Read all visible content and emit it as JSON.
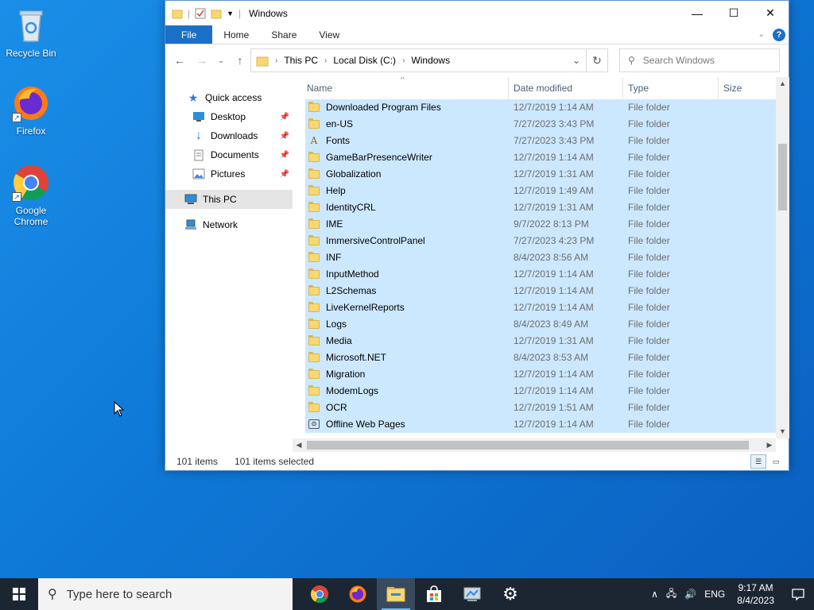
{
  "desktop": {
    "icons": [
      {
        "label": "Recycle Bin"
      },
      {
        "label": "Firefox"
      },
      {
        "label": "Google Chrome"
      }
    ]
  },
  "window": {
    "title": "Windows",
    "ribbon_tabs": [
      "File",
      "Home",
      "Share",
      "View"
    ],
    "address": {
      "crumbs": [
        "This PC",
        "Local Disk (C:)",
        "Windows"
      ]
    },
    "search_placeholder": "Search Windows",
    "nav": {
      "quick_access": "Quick access",
      "items": [
        "Desktop",
        "Downloads",
        "Documents",
        "Pictures"
      ],
      "this_pc": "This PC",
      "network": "Network"
    },
    "columns": [
      "Name",
      "Date modified",
      "Type",
      "Size"
    ],
    "rows": [
      {
        "name": "Downloaded Program Files",
        "date": "12/7/2019 1:14 AM",
        "type": "File folder",
        "icon": "folder"
      },
      {
        "name": "en-US",
        "date": "7/27/2023 3:43 PM",
        "type": "File folder",
        "icon": "folder"
      },
      {
        "name": "Fonts",
        "date": "7/27/2023 3:43 PM",
        "type": "File folder",
        "icon": "font"
      },
      {
        "name": "GameBarPresenceWriter",
        "date": "12/7/2019 1:14 AM",
        "type": "File folder",
        "icon": "folder"
      },
      {
        "name": "Globalization",
        "date": "12/7/2019 1:31 AM",
        "type": "File folder",
        "icon": "folder"
      },
      {
        "name": "Help",
        "date": "12/7/2019 1:49 AM",
        "type": "File folder",
        "icon": "folder"
      },
      {
        "name": "IdentityCRL",
        "date": "12/7/2019 1:31 AM",
        "type": "File folder",
        "icon": "folder"
      },
      {
        "name": "IME",
        "date": "9/7/2022 8:13 PM",
        "type": "File folder",
        "icon": "folder"
      },
      {
        "name": "ImmersiveControlPanel",
        "date": "7/27/2023 4:23 PM",
        "type": "File folder",
        "icon": "folder"
      },
      {
        "name": "INF",
        "date": "8/4/2023 8:56 AM",
        "type": "File folder",
        "icon": "folder"
      },
      {
        "name": "InputMethod",
        "date": "12/7/2019 1:14 AM",
        "type": "File folder",
        "icon": "folder"
      },
      {
        "name": "L2Schemas",
        "date": "12/7/2019 1:14 AM",
        "type": "File folder",
        "icon": "folder"
      },
      {
        "name": "LiveKernelReports",
        "date": "12/7/2019 1:14 AM",
        "type": "File folder",
        "icon": "folder"
      },
      {
        "name": "Logs",
        "date": "8/4/2023 8:49 AM",
        "type": "File folder",
        "icon": "folder"
      },
      {
        "name": "Media",
        "date": "12/7/2019 1:31 AM",
        "type": "File folder",
        "icon": "folder"
      },
      {
        "name": "Microsoft.NET",
        "date": "8/4/2023 8:53 AM",
        "type": "File folder",
        "icon": "folder"
      },
      {
        "name": "Migration",
        "date": "12/7/2019 1:14 AM",
        "type": "File folder",
        "icon": "folder"
      },
      {
        "name": "ModemLogs",
        "date": "12/7/2019 1:14 AM",
        "type": "File folder",
        "icon": "folder"
      },
      {
        "name": "OCR",
        "date": "12/7/2019 1:51 AM",
        "type": "File folder",
        "icon": "folder"
      },
      {
        "name": "Offline Web Pages",
        "date": "12/7/2019 1:14 AM",
        "type": "File folder",
        "icon": "web"
      }
    ],
    "status": {
      "count": "101 items",
      "selected": "101 items selected"
    }
  },
  "taskbar": {
    "search_placeholder": "Type here to search",
    "language": "ENG",
    "time": "9:17 AM",
    "date": "8/4/2023"
  },
  "colors": {
    "selection": "#cce8ff",
    "accent": "#1a6fc9",
    "taskbar": "#1c2633"
  }
}
